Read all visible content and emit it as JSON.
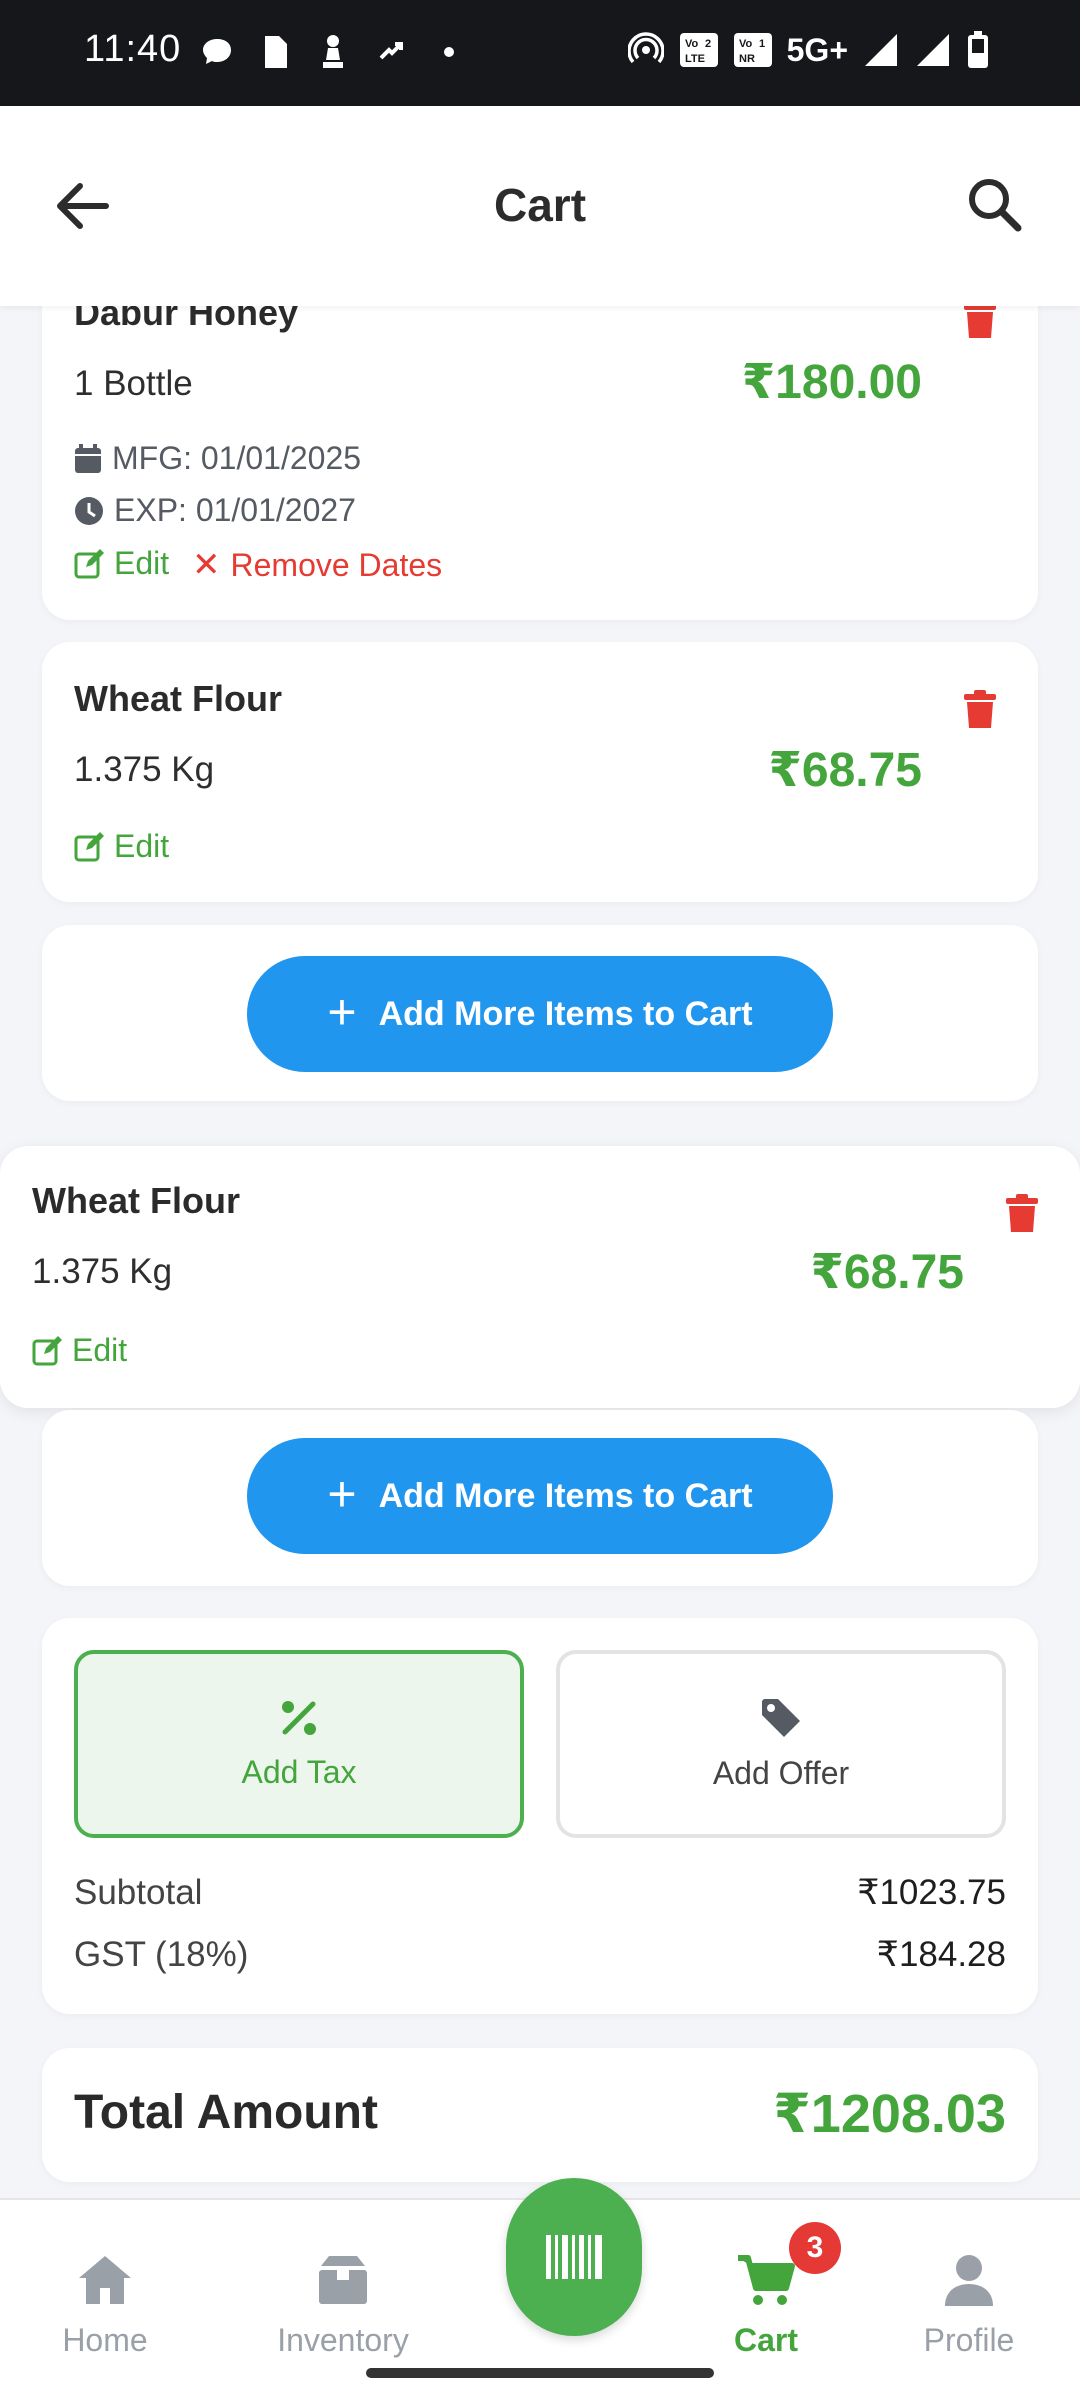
{
  "status_bar": {
    "time": "11:40",
    "network": "5G+",
    "icons": [
      "chat-bubble-icon",
      "document-icon",
      "chess-pawn-icon",
      "link-icon",
      "dot-icon",
      "hotspot-icon",
      "volte-icon",
      "vonr-icon",
      "signal-icon",
      "battery-icon"
    ],
    "volte_label": "Vo LTE 2",
    "vonr_label": "Vo NR 1"
  },
  "header": {
    "title": "Cart"
  },
  "items": [
    {
      "name": "Dabur Honey",
      "quantity": "1 Bottle",
      "price": "₹180.00",
      "mfg": "MFG: 01/01/2025",
      "exp": "EXP: 01/01/2027",
      "edit_label": "Edit",
      "remove_dates_label": "Remove Dates"
    },
    {
      "name": "Wheat Flour",
      "quantity": "1.375 Kg",
      "price": "₹68.75",
      "edit_label": "Edit"
    },
    {
      "name": "Wheat Flour",
      "quantity": "1.375 Kg",
      "price": "₹68.75",
      "edit_label": "Edit"
    }
  ],
  "add_more_label": "Add More Items to Cart",
  "options": {
    "add_tax": "Add Tax",
    "add_offer": "Add Offer"
  },
  "summary": {
    "subtotal_label": "Subtotal",
    "subtotal_value": "₹1023.75",
    "gst_label": "GST (18%)",
    "gst_value": "₹184.28"
  },
  "total": {
    "label": "Total Amount",
    "value": "₹1208.03"
  },
  "nav": {
    "home": "Home",
    "inventory": "Inventory",
    "cart": "Cart",
    "profile": "Profile",
    "cart_badge": "3",
    "active": "Cart"
  },
  "colors": {
    "accent_green": "#43a53c",
    "primary_blue": "#2196ef",
    "danger_red": "#e53b33",
    "status_bar_bg": "#16171b"
  }
}
